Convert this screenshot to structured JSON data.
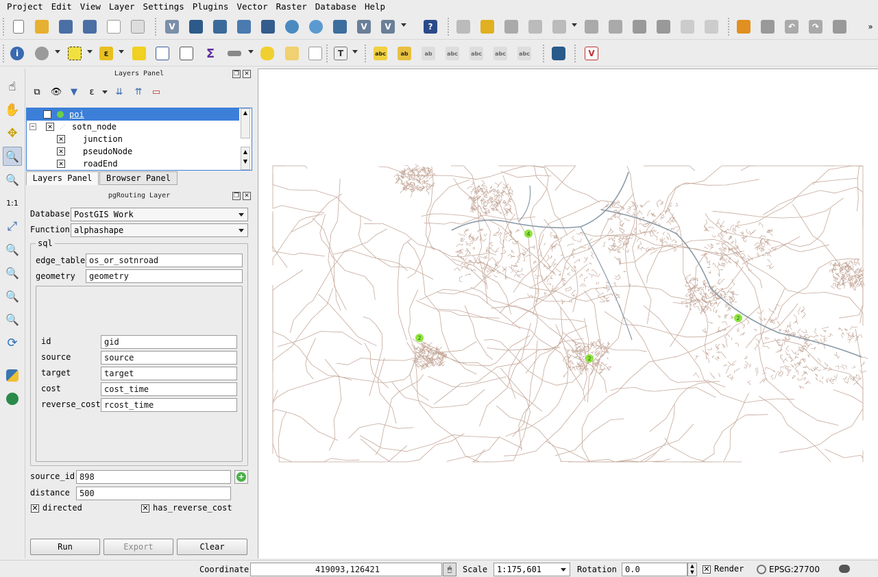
{
  "menu": [
    "Project",
    "Edit",
    "View",
    "Layer",
    "Settings",
    "Plugins",
    "Vector",
    "Raster",
    "Database",
    "Help"
  ],
  "layers_panel": {
    "title": "Layers Panel",
    "tree": [
      {
        "name": "poi",
        "checked": true
      },
      {
        "name": "sotn_node",
        "checked": true
      },
      {
        "name": "junction",
        "checked": true
      },
      {
        "name": "pseudoNode",
        "checked": true
      },
      {
        "name": "roadEnd",
        "checked": true
      }
    ],
    "tabs": [
      "Layers Panel",
      "Browser Panel"
    ]
  },
  "pgrouting": {
    "title": "pgRouting Layer",
    "database_label": "Database",
    "database_value": "PostGIS Work",
    "function_label": "Function",
    "function_value": "alphashape",
    "sql_group": "sql",
    "edge_table_label": "edge_table",
    "edge_table_value": "os_or_sotnroad",
    "geometry_label": "geometry",
    "geometry_value": "geometry",
    "id_label": "id",
    "id_value": "gid",
    "source_label": "source",
    "source_value": "source",
    "target_label": "target",
    "target_value": "target",
    "cost_label": "cost",
    "cost_value": "cost_time",
    "reverse_cost_label": "reverse_cost",
    "reverse_cost_value": "rcost_time",
    "source_id_label": "source_id",
    "source_id_value": "898",
    "distance_label": "distance",
    "distance_value": "500",
    "directed_label": "directed",
    "has_reverse_cost_label": "has_reverse_cost",
    "run_label": "Run",
    "export_label": "Export",
    "clear_label": "Clear"
  },
  "status": {
    "coordinate_label": "Coordinate",
    "coordinate_value": "419093,126421",
    "scale_label": "Scale",
    "scale_value": "1:175,601",
    "rotation_label": "Rotation",
    "rotation_value": "0.0",
    "render_label": "Render",
    "crs": "EPSG:27700"
  },
  "map": {
    "poi_labels": [
      "4",
      "2",
      "2",
      "2"
    ],
    "road_color": "#c4a89a",
    "major_road_color": "#8a9aa6",
    "poi_color": "#7be01e"
  }
}
